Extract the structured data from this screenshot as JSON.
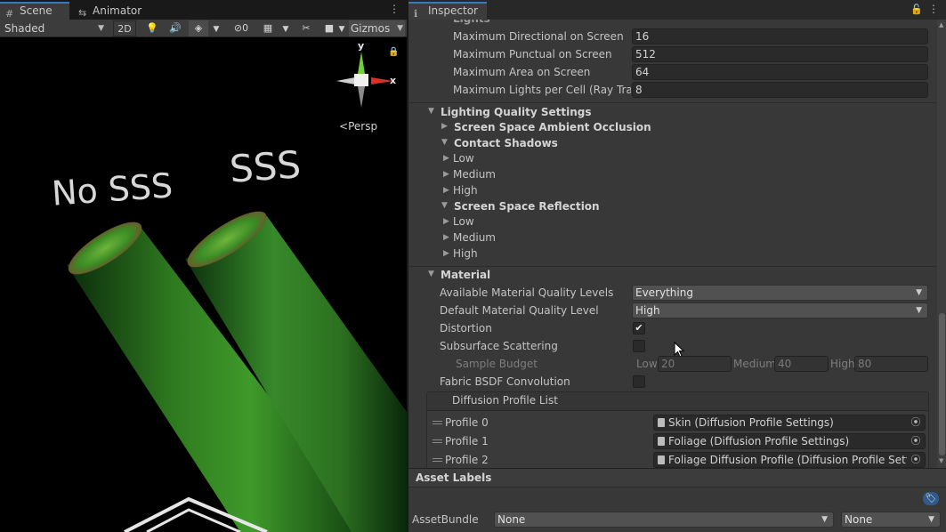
{
  "scene": {
    "tab_scene": "Scene",
    "tab_animator": "Animator",
    "draw_mode": "Shaded",
    "btn_2d": "2D",
    "hidden_count": "0",
    "gizmos": "Gizmos",
    "gizmo_y": "y",
    "gizmo_x": "x",
    "persp": "Persp",
    "label_no_sss": "No SSS",
    "label_sss": "SSS"
  },
  "inspector": {
    "tab": "Inspector",
    "lights_header": "Lights",
    "lights": [
      {
        "label": "Maximum Directional on Screen",
        "value": "16"
      },
      {
        "label": "Maximum Punctual on Screen",
        "value": "512"
      },
      {
        "label": "Maximum Area on Screen",
        "value": "64"
      },
      {
        "label": "Maximum Lights per Cell (Ray Tracing)",
        "value": "8"
      }
    ],
    "lighting_quality": {
      "header": "Lighting Quality Settings",
      "ssao": "Screen Space Ambient Occlusion",
      "contact_shadows": "Contact Shadows",
      "cs_low": "Low",
      "cs_medium": "Medium",
      "cs_high": "High",
      "ssr": "Screen Space Reflection",
      "ssr_low": "Low",
      "ssr_medium": "Medium",
      "ssr_high": "High"
    },
    "material": {
      "header": "Material",
      "available_label": "Available Material Quality Levels",
      "available_value": "Everything",
      "default_label": "Default Material Quality Level",
      "default_value": "High",
      "distortion_label": "Distortion",
      "distortion_checked": true,
      "sss_label": "Subsurface Scattering",
      "sss_checked": false,
      "sample_budget_label": "Sample Budget",
      "low_label": "Low",
      "low_value": "20",
      "medium_label": "Medium",
      "medium_value": "40",
      "high_label": "High",
      "high_value": "80",
      "fabric_label": "Fabric BSDF Convolution",
      "fabric_checked": false,
      "diffusion_header": "Diffusion Profile List",
      "profiles": [
        {
          "label": "Profile 0",
          "value": "Skin (Diffusion Profile Settings)"
        },
        {
          "label": "Profile 1",
          "value": "Foliage (Diffusion Profile Settings)"
        },
        {
          "label": "Profile 2",
          "value": "Foliage Diffusion Profile (Diffusion Profile Settings)"
        }
      ]
    },
    "asset_labels": "Asset Labels",
    "asset_bundle_label": "AssetBundle",
    "asset_bundle_value": "None",
    "asset_bundle_variant": "None"
  }
}
